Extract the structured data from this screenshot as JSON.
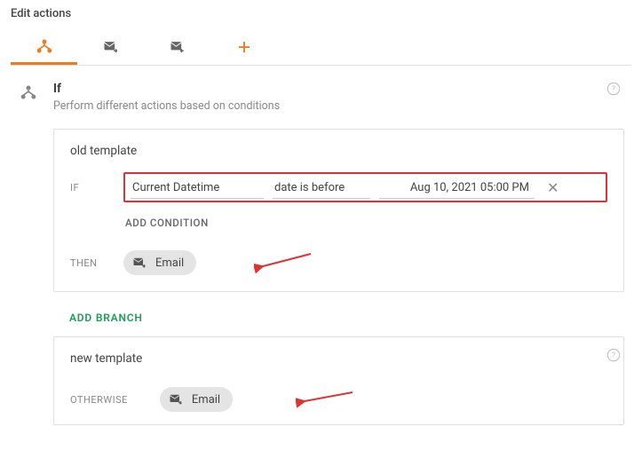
{
  "header": {
    "title": "Edit actions"
  },
  "section": {
    "title": "If",
    "subtitle": "Perform different actions based on conditions"
  },
  "branchA": {
    "name": "old template",
    "ifLabel": "IF",
    "cond": {
      "lhs": "Current Datetime",
      "op": "date is before",
      "rhs": "Aug 10, 2021  05:00 PM"
    },
    "addCond": "ADD CONDITION",
    "thenLabel": "THEN",
    "action": "Email"
  },
  "addBranch": "ADD BRANCH",
  "branchB": {
    "name": "new template",
    "otherwiseLabel": "OTHERWISE",
    "action": "Email"
  }
}
